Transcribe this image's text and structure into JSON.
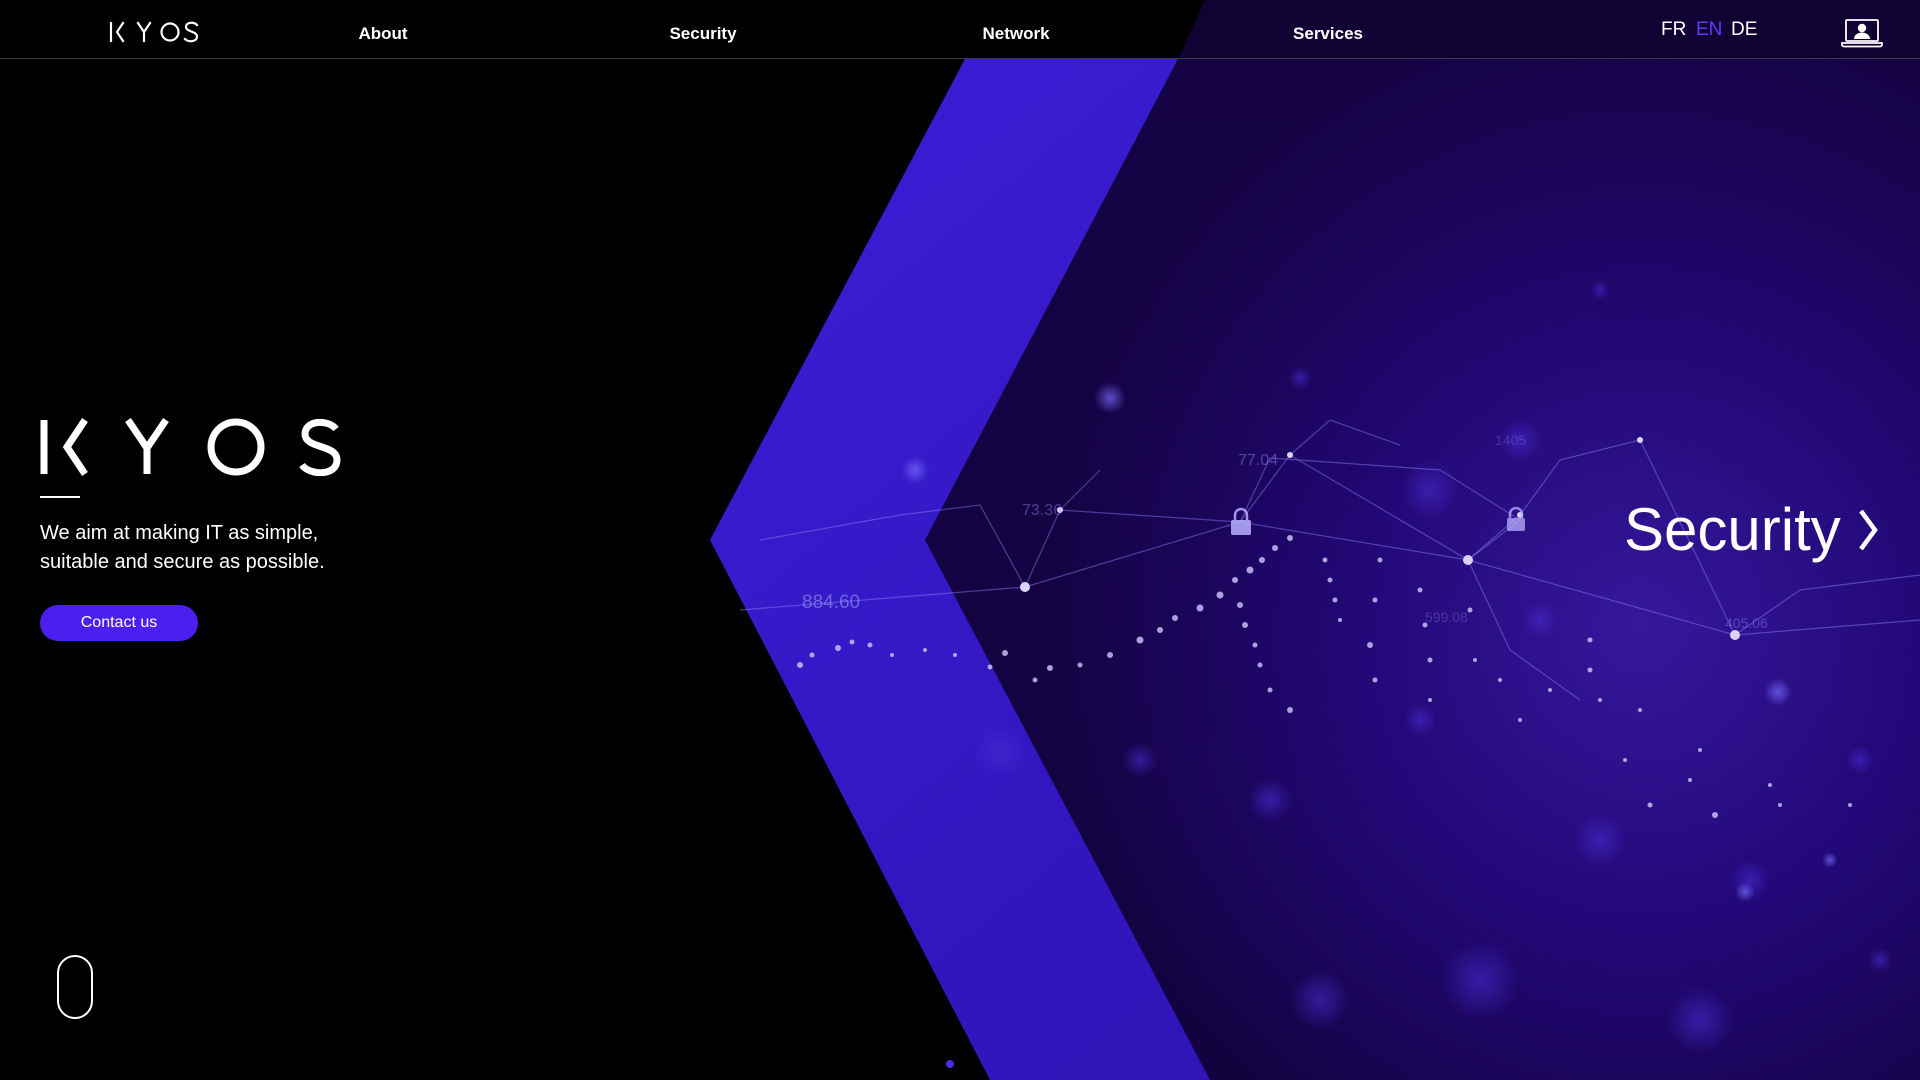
{
  "brand": {
    "name": "KYOS",
    "logo_letters": [
      "K",
      "Y",
      "O",
      "S"
    ]
  },
  "nav": {
    "items": [
      {
        "label": "About"
      },
      {
        "label": "Security"
      },
      {
        "label": "Network"
      },
      {
        "label": "Services"
      }
    ]
  },
  "languages": {
    "options": [
      "FR",
      "EN",
      "DE"
    ],
    "active": "EN"
  },
  "header": {
    "client_icon": "laptop-user-icon"
  },
  "hero": {
    "tagline_line1": "We aim at making IT as simple,",
    "tagline_line2": "suitable and secure as possible.",
    "cta_label": "Contact us",
    "slide_title": "Security",
    "slide_icon": "chevron-right-icon",
    "scroll_icon": "mouse-scroll-icon",
    "bg_numbers": [
      "884.60",
      "77.04",
      "73.36",
      "405.06",
      "599.08",
      "1405"
    ]
  },
  "colors": {
    "accent": "#4a1ff0",
    "active_lang": "#5b3bff",
    "background": "#000000",
    "deep_purple": "#1a0457",
    "band_purple": "#3a1cd0"
  }
}
